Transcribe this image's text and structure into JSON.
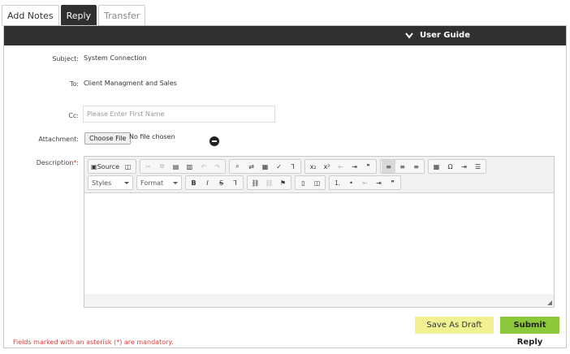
{
  "tabs": [
    {
      "label": "Add Notes"
    },
    {
      "label": "Reply"
    },
    {
      "label": "Transfer"
    }
  ],
  "header": {
    "guide_label": "User Guide"
  },
  "form": {
    "subject_label": "Subject:",
    "subject_value": "System Connection",
    "to_label": "To:",
    "to_value": "Client Managment and Sales",
    "cc_label": "Cc:",
    "cc_placeholder": "Please Enter First Name",
    "attachment_label": "Attachment:",
    "choose_file_label": "Choose File",
    "file_status": "No file chosen",
    "description_label": "Description",
    "required_mark": "*",
    "description_colon": ":"
  },
  "editor": {
    "source_label": "Source",
    "styles_label": "Styles",
    "format_label": "Format"
  },
  "actions": {
    "save_draft_label": "Save As Draft",
    "submit_label": "Submit Reply"
  },
  "footer": {
    "mandatory_note": "Fields marked with an asterisk (*) are mandatory."
  },
  "colors": {
    "dark_bar": "#303030",
    "draft_button": "#f1f193",
    "submit_button": "#8bc93b",
    "error_text": "#e03a3a"
  }
}
